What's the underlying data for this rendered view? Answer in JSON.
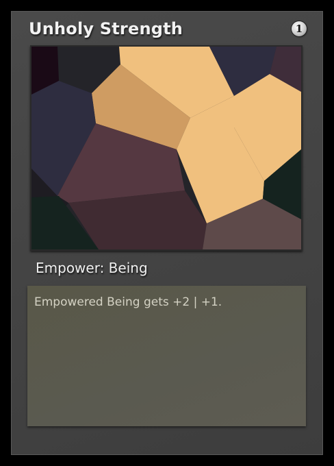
{
  "card": {
    "title": "Unholy Strength",
    "cost": "1",
    "type_line": "Empower: Being",
    "rules_text": "Empowered Being gets +2 | +1."
  },
  "art": {
    "style": "voronoi-polygons",
    "colors": {
      "peach": "#f0c07e",
      "tan": "#cf9c62",
      "plum": "#553841",
      "dark_plum": "#402b32",
      "navy": "#2e2d40",
      "charcoal": "#242429",
      "dark_green": "#15231f",
      "mauve": "#5e4a4a",
      "aubergine": "#3f2d3a",
      "black_purple": "#1a0a16"
    }
  }
}
